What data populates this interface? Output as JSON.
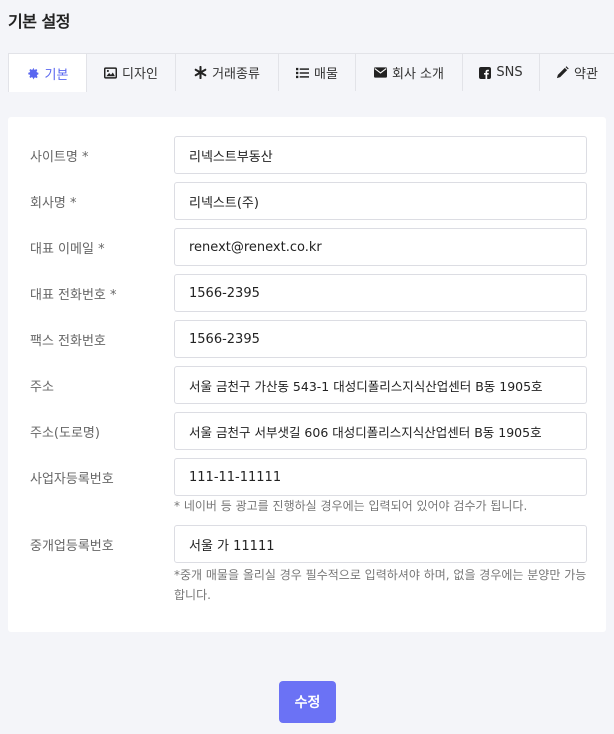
{
  "page_title": "기본 설정",
  "tabs": [
    {
      "label": "기본",
      "icon": "gear-icon"
    },
    {
      "label": "디자인",
      "icon": "image-icon"
    },
    {
      "label": "거래종류",
      "icon": "asterisk-icon"
    },
    {
      "label": "매물",
      "icon": "list-icon"
    },
    {
      "label": "회사 소개",
      "icon": "envelope-icon"
    },
    {
      "label": "SNS",
      "icon": "facebook-icon"
    },
    {
      "label": "약관",
      "icon": "pen-icon"
    }
  ],
  "form": {
    "site_name": {
      "label": "사이트명 *",
      "value": "리넥스트부동산"
    },
    "company_name": {
      "label": "회사명 *",
      "value": "리넥스트(주)"
    },
    "email": {
      "label": "대표 이메일 *",
      "value": "renext@renext.co.kr"
    },
    "phone": {
      "label": "대표 전화번호 *",
      "value": "1566-2395"
    },
    "fax": {
      "label": "팩스 전화번호",
      "value": "1566-2395"
    },
    "address": {
      "label": "주소",
      "value": "서울 금천구 가산동 543-1 대성디폴리스지식산업센터 B동 1905호"
    },
    "road_address": {
      "label": "주소(도로명)",
      "value": "서울 금천구 서부샛길 606 대성디폴리스지식산업센터 B동 1905호"
    },
    "business_no": {
      "label": "사업자등록번호",
      "value": "111-11-11111",
      "help": "* 네이버 등 광고를 진행하실 경우에는 입력되어 있어야 검수가 됩니다."
    },
    "broker_no": {
      "label": "중개업등록번호",
      "value": "서울 가 11111",
      "help": "*중개 매물을 올리실 경우 필수적으로 입력하셔야 하며, 없을 경우에는 분양만 가능합니다."
    }
  },
  "submit_label": "수정",
  "colors": {
    "accent": "#5a67f0",
    "button": "#6b72f5"
  }
}
